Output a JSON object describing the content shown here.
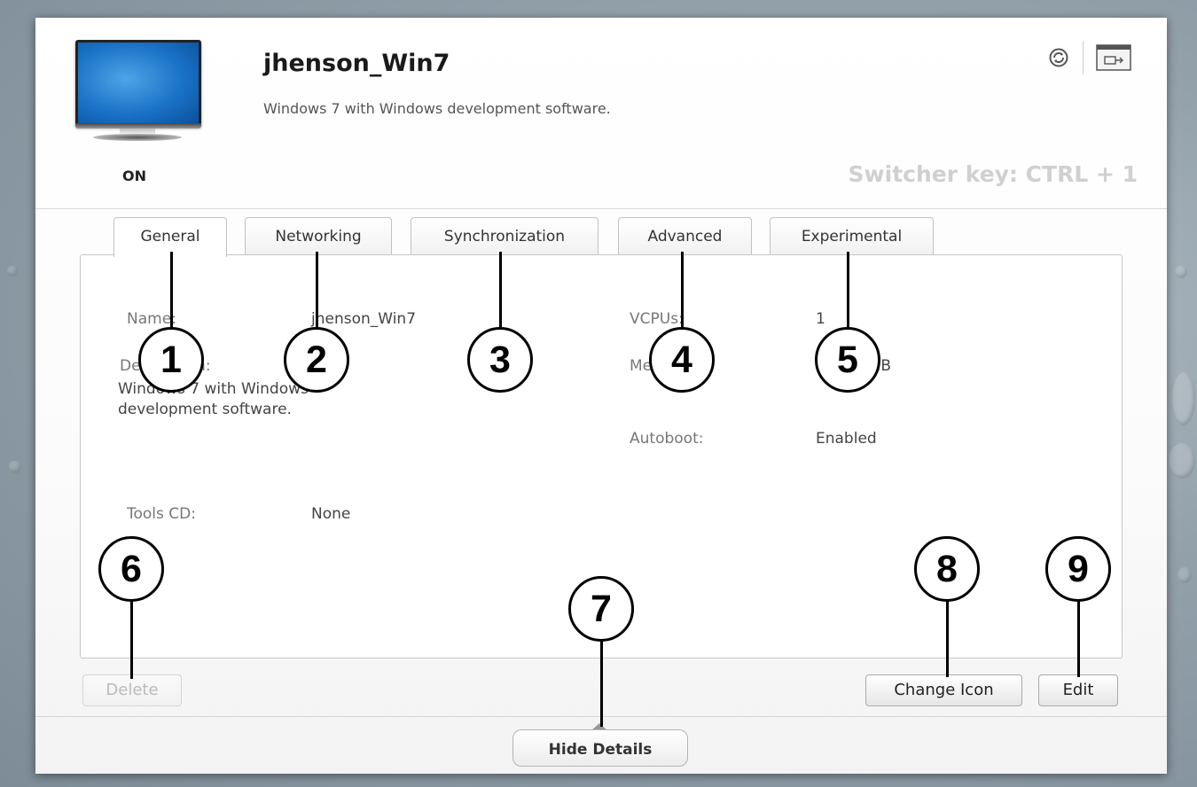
{
  "vm": {
    "name": "jhenson_Win7",
    "description": "Windows 7 with Windows development software.",
    "state": "ON",
    "switcher_key": "Switcher key: CTRL + 1"
  },
  "header_icons": [
    "sync-icon",
    "window-icon"
  ],
  "tabs": [
    {
      "label": "General",
      "active": true
    },
    {
      "label": "Networking",
      "active": false
    },
    {
      "label": "Synchronization",
      "active": false
    },
    {
      "label": "Advanced",
      "active": false
    },
    {
      "label": "Experimental",
      "active": false
    }
  ],
  "general": {
    "name_label": "Name:",
    "name_value": "jhenson_Win7",
    "description_label": "Description:",
    "description_value": "Windows 7 with Windows development software.",
    "tools_cd_label": "Tools CD:",
    "tools_cd_value": "None",
    "vcpus_label": "VCPUs:",
    "vcpus_value": "1",
    "memory_label": "Memory:",
    "memory_value": "1024 MB",
    "autoboot_label": "Autoboot:",
    "autoboot_value": "Enabled"
  },
  "buttons": {
    "delete": "Delete",
    "change_icon": "Change Icon",
    "edit": "Edit",
    "hide_details": "Hide Details"
  },
  "callouts": [
    "1",
    "2",
    "3",
    "4",
    "5",
    "6",
    "7",
    "8",
    "9"
  ],
  "colors": {
    "screen_blue": "#1a72c7",
    "switcher_text": "#d0d0d0",
    "disabled_text": "#bbbbbb"
  }
}
